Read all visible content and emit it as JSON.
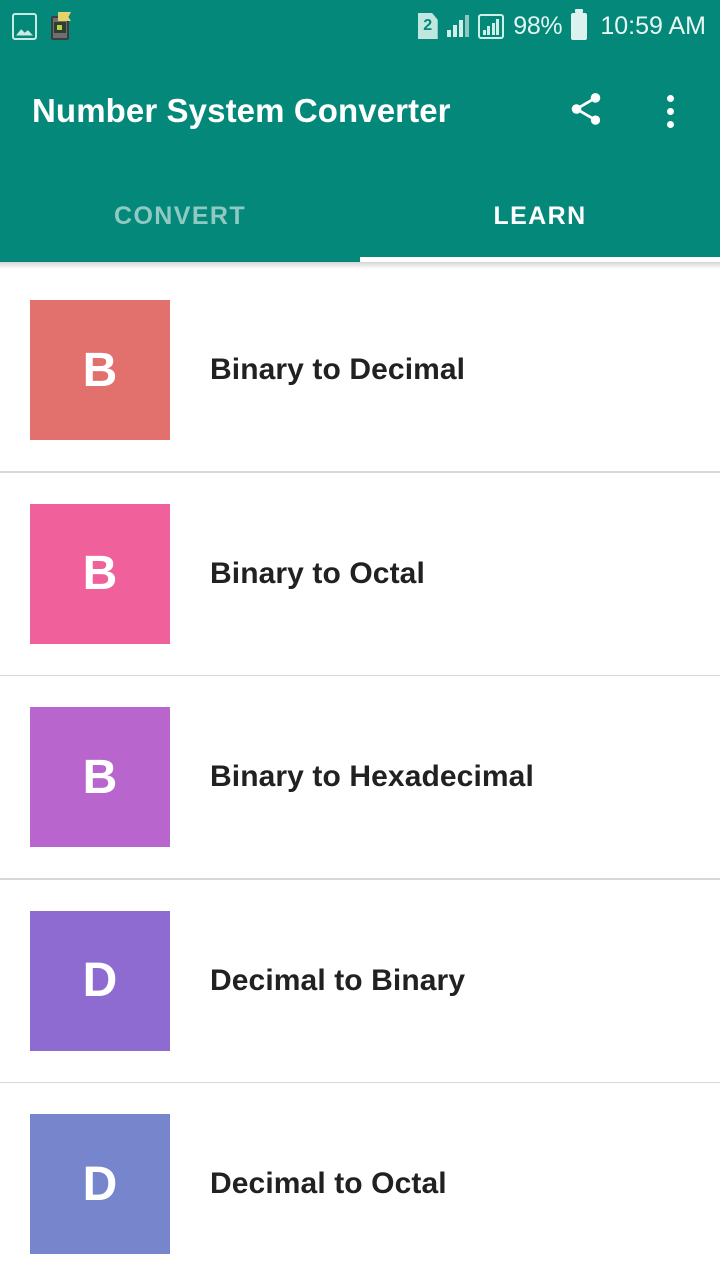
{
  "status_bar": {
    "left_icons": [
      "gallery-icon",
      "app-notification-icon"
    ],
    "sim_badge": "2",
    "signal_icon": "signal-bars-icon",
    "data_signal_icon": "boxed-signal-bars-icon",
    "battery_percent": "98%",
    "battery_icon": "battery-full-icon",
    "time": "10:59 AM"
  },
  "app_bar": {
    "title": "Number System Converter",
    "share_icon": "share-icon",
    "overflow_icon": "overflow-menu-icon"
  },
  "tabs": {
    "items": [
      {
        "label": "CONVERT",
        "active": false
      },
      {
        "label": "LEARN",
        "active": true
      }
    ]
  },
  "learn_list": {
    "items": [
      {
        "letter": "B",
        "label": "Binary to Decimal",
        "color": "#E2706D"
      },
      {
        "letter": "B",
        "label": "Binary to Octal",
        "color": "#F0609A"
      },
      {
        "letter": "B",
        "label": "Binary to Hexadecimal",
        "color": "#B865CE"
      },
      {
        "letter": "D",
        "label": "Decimal to Binary",
        "color": "#8E6BD0"
      },
      {
        "letter": "D",
        "label": "Decimal to Octal",
        "color": "#7685CC"
      }
    ]
  },
  "colors": {
    "primary": "#03887A",
    "tab_inactive": "#8FC9C1",
    "divider": "#D6D7D9",
    "text": "#212121"
  }
}
